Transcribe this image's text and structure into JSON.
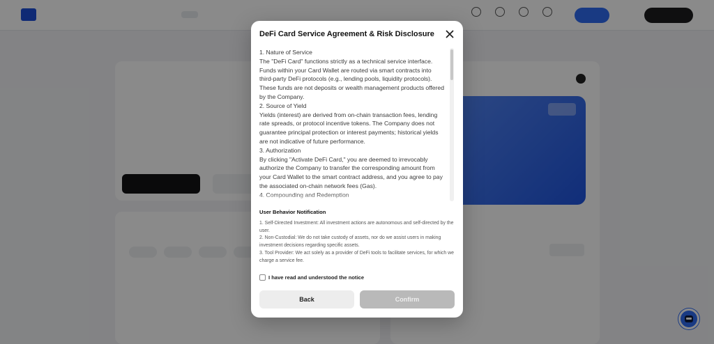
{
  "modal": {
    "title": "DeFi Card Service Agreement & Risk Disclosure",
    "agreement_paragraphs": [
      "1. Nature of Service",
      "The \"DeFi Card\" functions strictly as a technical service interface. Funds within your Card Wallet are routed via smart contracts into third-party DeFi protocols (e.g., lending pools, liquidity protocols). These funds are not deposits or wealth management products offered by the Company.",
      "2. Source of Yield",
      "Yields (interest) are derived from on-chain transaction fees, lending rate spreads, or protocol incentive tokens. The Company does not guarantee principal protection or interest payments; historical yields are not indicative of future performance.",
      "3. Authorization",
      "By clicking \"Activate DeFi Card,\" you are deemed to irrevocably authorize the Company to transfer the corresponding amount from your Card Wallet to the smart contract address, and you agree to pay the associated on-chain network fees (Gas).",
      "4. Compounding and Redemption"
    ],
    "notice_title": "User Behavior Notification",
    "notice_items": [
      "1. Self-Directed Investment: All investment actions are autonomous and self-directed by the user.",
      "2. Non-Custodial: We do not take custody of assets, nor do we assist users in making investment decisions regarding specific assets.",
      "3. Tool Provider: We act solely as a provider of DeFi tools to facilitate services, for which we charge a service fee."
    ],
    "checkbox_label": "I have read and understood the notice",
    "back_label": "Back",
    "confirm_label": "Confirm"
  },
  "colors": {
    "accent": "#2f6bf2",
    "confirm_disabled": "#b9b9b9",
    "overlay": "rgba(0,0,0,0.46)"
  },
  "icons": {
    "close": "close-icon",
    "help": "robot-help-icon"
  }
}
